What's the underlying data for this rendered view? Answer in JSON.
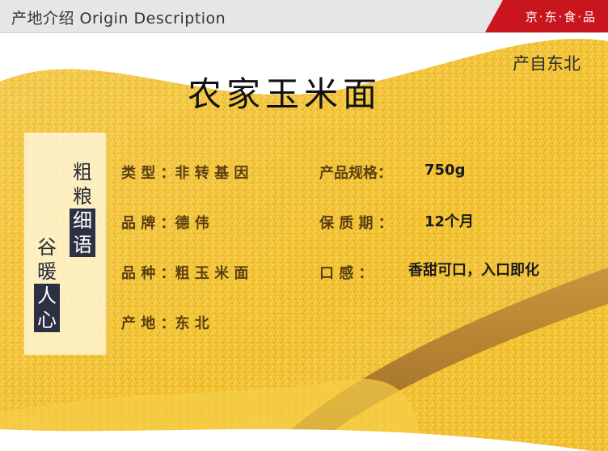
{
  "header": {
    "title": "产地介绍  Origin Description",
    "badge": "京·东·食·品"
  },
  "banner": {
    "origin_note": "产自东北",
    "title": "农家玉米面",
    "slogan_a": [
      "粗",
      "粮",
      "细",
      "语"
    ],
    "slogan_b": [
      "谷",
      "暖",
      "人",
      "心"
    ]
  },
  "specs": {
    "type_label": "类 型 ：非 转 基 因",
    "brand_label": "品 牌 ：德    伟",
    "variety_label": "品 种 ：粗 玉 米 面",
    "origin_label": "产 地 ：东    北",
    "size_label": "产品规格：",
    "size_value": "750g",
    "shelf_label": "保 质 期 ：",
    "shelf_value": "12个月",
    "taste_label": "口   感  ：",
    "taste_value": "香甜可口，入口即化"
  },
  "colors": {
    "brand_red": "#c9151e",
    "corn_yellow": "#f2c232",
    "slogan_dark": "#2d3043"
  }
}
